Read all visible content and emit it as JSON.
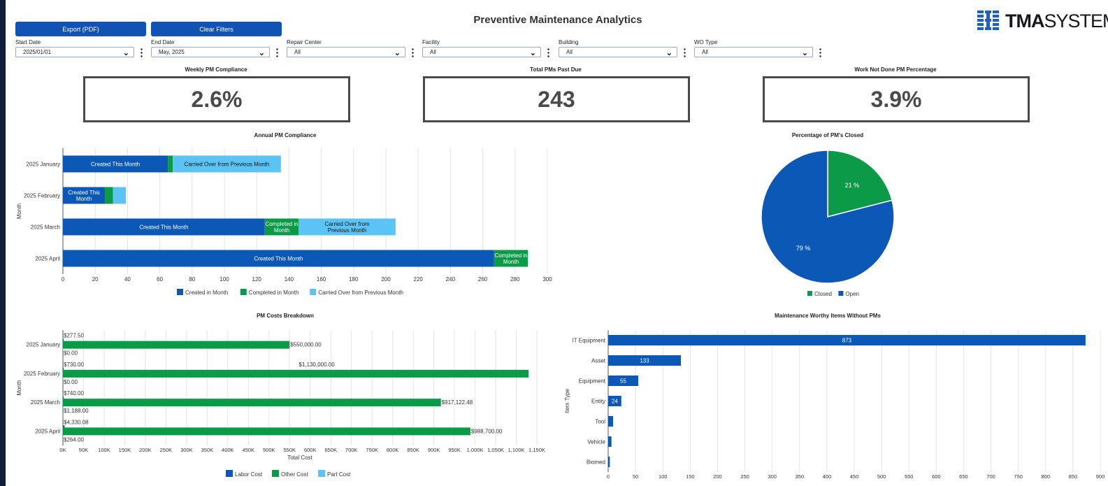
{
  "header": {
    "title": "Preventive Maintenance Analytics",
    "export_label": "Export (PDF)",
    "clear_label": "Clear Filters",
    "logo_bold": "TMA",
    "logo_light": "SYSTEMS"
  },
  "filters": [
    {
      "label": "Start Date",
      "value": "2025/01/01"
    },
    {
      "label": "End Date",
      "value": "May, 2025"
    },
    {
      "label": "Repair Center",
      "value": "All"
    },
    {
      "label": "Facility",
      "value": "All"
    },
    {
      "label": "Building",
      "value": "All"
    },
    {
      "label": "WO Type",
      "value": "All"
    }
  ],
  "kpis": [
    {
      "title": "Weekly PM Compliance",
      "value": "2.6%"
    },
    {
      "title": "Total PMs Past Due",
      "value": "243"
    },
    {
      "title": "Work Not Done PM Percentage",
      "value": "3.9%"
    }
  ],
  "colors": {
    "accent": "#1053b5",
    "created": "#0c58b6",
    "completed": "#0a9a48",
    "carried": "#5bc4f5",
    "grid": "#e4e4e4",
    "axis": "#555555"
  },
  "chart_data": [
    {
      "id": "annual",
      "type": "bar",
      "orientation": "horizontal",
      "stacked": true,
      "title": "Annual PM Compliance",
      "ylabel": "Month",
      "categories": [
        "2025 January",
        "2025 February",
        "2025 March",
        "2025 April"
      ],
      "series": [
        {
          "name": "Created in Month",
          "values": [
            65,
            26,
            125,
            267
          ],
          "labels": [
            "Created This Month",
            "Created This Month",
            "Created This Month",
            "Created This Month"
          ]
        },
        {
          "name": "Completed in Month",
          "values": [
            3,
            5,
            21,
            21
          ],
          "labels": [
            "",
            "",
            "Completed in Month",
            "Completed in Month"
          ]
        },
        {
          "name": "Carried Over from Previous Month",
          "values": [
            67,
            8,
            60,
            0
          ],
          "labels": [
            "Carried Over from Previous Month",
            "",
            "Carried Over from Previous Month",
            ""
          ]
        }
      ],
      "xlim": [
        0,
        300
      ],
      "xticks": [
        0,
        20,
        40,
        60,
        80,
        100,
        120,
        140,
        160,
        180,
        200,
        220,
        240,
        260,
        280,
        300
      ],
      "grid": true,
      "legend": "bottom"
    },
    {
      "id": "pie",
      "type": "pie",
      "title": "Percentage of PM's Closed",
      "slices": [
        {
          "name": "Closed",
          "value": 21,
          "label": "21 %"
        },
        {
          "name": "Open",
          "value": 79,
          "label": "79 %"
        }
      ],
      "legend": "bottom"
    },
    {
      "id": "costs",
      "type": "bar",
      "orientation": "horizontal",
      "title": "PM Costs Breakdown",
      "xlabel": "Total Cost",
      "ylabel": "Month",
      "categories": [
        "2025 January",
        "2025 February",
        "2025 March",
        "2025 April"
      ],
      "series": [
        {
          "name": "Labor Cost",
          "values": [
            277.5,
            730,
            740,
            4330.08
          ],
          "labels": [
            "$277.50",
            "$730.00",
            "$740.00",
            "$4,330.08"
          ]
        },
        {
          "name": "Other Cost",
          "values": [
            550000,
            1130000,
            917122.48,
            988700
          ],
          "labels": [
            "$550,000.00",
            "$1,130,000.00",
            "$917,122.48",
            "$988,700.00"
          ]
        },
        {
          "name": "Part Cost",
          "values": [
            0,
            0,
            1188,
            264
          ],
          "labels": [
            "$0.00",
            "$0.00",
            "$1,188.00",
            "$264.00"
          ]
        }
      ],
      "xlim": [
        0,
        1150000
      ],
      "xticks": [
        0,
        50000,
        100000,
        150000,
        200000,
        250000,
        300000,
        350000,
        400000,
        450000,
        500000,
        550000,
        600000,
        650000,
        700000,
        750000,
        800000,
        850000,
        900000,
        950000,
        1000000,
        1050000,
        1100000,
        1150000
      ],
      "xtick_labels": [
        "0K",
        "50K",
        "100K",
        "150K",
        "200K",
        "250K",
        "300K",
        "350K",
        "400K",
        "450K",
        "500K",
        "550K",
        "600K",
        "650K",
        "700K",
        "750K",
        "800K",
        "850K",
        "900K",
        "950K",
        "1,000K",
        "1,050K",
        "1,100K",
        "1,150K"
      ],
      "grid": true,
      "legend": "bottom"
    },
    {
      "id": "items",
      "type": "bar",
      "orientation": "horizontal",
      "title": "Maintenance Worthy Items Without PMs",
      "ylabel": "Item Type",
      "categories": [
        "IT Equipment",
        "Asset",
        "Equipment",
        "Entity",
        "Tool",
        "Vehicle",
        "Biomed"
      ],
      "values": [
        873,
        133,
        55,
        24,
        9,
        6,
        3
      ],
      "labels": [
        "873",
        "133",
        "55",
        "24",
        "",
        "",
        ""
      ],
      "xlim": [
        0,
        900
      ],
      "xticks": [
        0,
        50,
        100,
        150,
        200,
        250,
        300,
        350,
        400,
        450,
        500,
        550,
        600,
        650,
        700,
        750,
        800,
        850,
        900
      ],
      "grid": true
    }
  ]
}
